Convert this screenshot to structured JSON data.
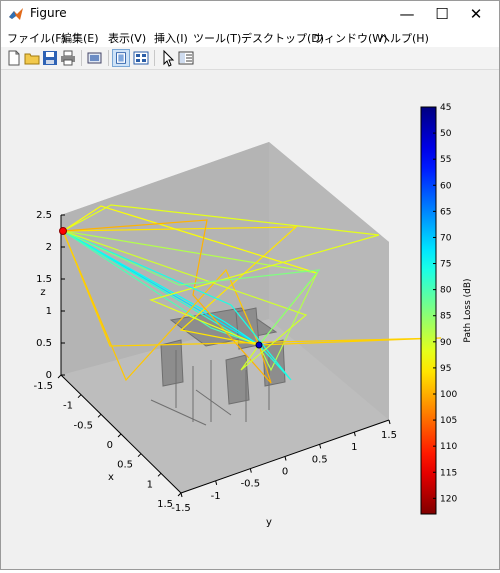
{
  "window": {
    "title": "Figure",
    "minimize": "—",
    "maximize": "☐",
    "close": "✕"
  },
  "menu": [
    {
      "label": "ファイル(F)"
    },
    {
      "label": "編集(E)"
    },
    {
      "label": "表示(V)"
    },
    {
      "label": "挿入(I)"
    },
    {
      "label": "ツール(T)"
    },
    {
      "label": "デスクトップ(D)"
    },
    {
      "label": "ウィンドウ(W)"
    },
    {
      "label": "ヘルプ(H)"
    }
  ],
  "toolbar": [
    "new-file-icon",
    "open-folder-icon",
    "save-icon",
    "print-icon",
    "print-preview-icon",
    "dock-figure-icon",
    "plot-tools-icon",
    "pointer-icon",
    "property-editor-icon"
  ],
  "chart_data": {
    "type": "3d-line",
    "axes": {
      "x": {
        "label": "x",
        "ticks": [
          "-1.5",
          "-1",
          "-0.5",
          "0",
          "0.5",
          "1",
          "1.5"
        ],
        "lim": [
          -1.5,
          1.5
        ]
      },
      "y": {
        "label": "y",
        "ticks": [
          "-1.5",
          "-1",
          "-0.5",
          "0",
          "0.5",
          "1",
          "1.5"
        ],
        "lim": [
          -1.5,
          1.5
        ]
      },
      "z": {
        "label": "z",
        "ticks": [
          "0",
          "0.5",
          "1",
          "1.5",
          "2",
          "2.5"
        ],
        "lim": [
          0,
          2.5
        ]
      }
    },
    "colorbar": {
      "label": "Path Loss (dB)",
      "ticks": [
        "45",
        "50",
        "55",
        "60",
        "65",
        "70",
        "75",
        "80",
        "85",
        "90",
        "95",
        "100",
        "105",
        "110",
        "115",
        "120"
      ],
      "lim": [
        45,
        123
      ],
      "colormap": "jet-reversed"
    },
    "transmitter": {
      "color": "#ff0000"
    },
    "receiver": {
      "color": "#0000cc"
    },
    "colors": {
      "background": "#bdbdbd",
      "accent": "#4e7fc1"
    }
  }
}
